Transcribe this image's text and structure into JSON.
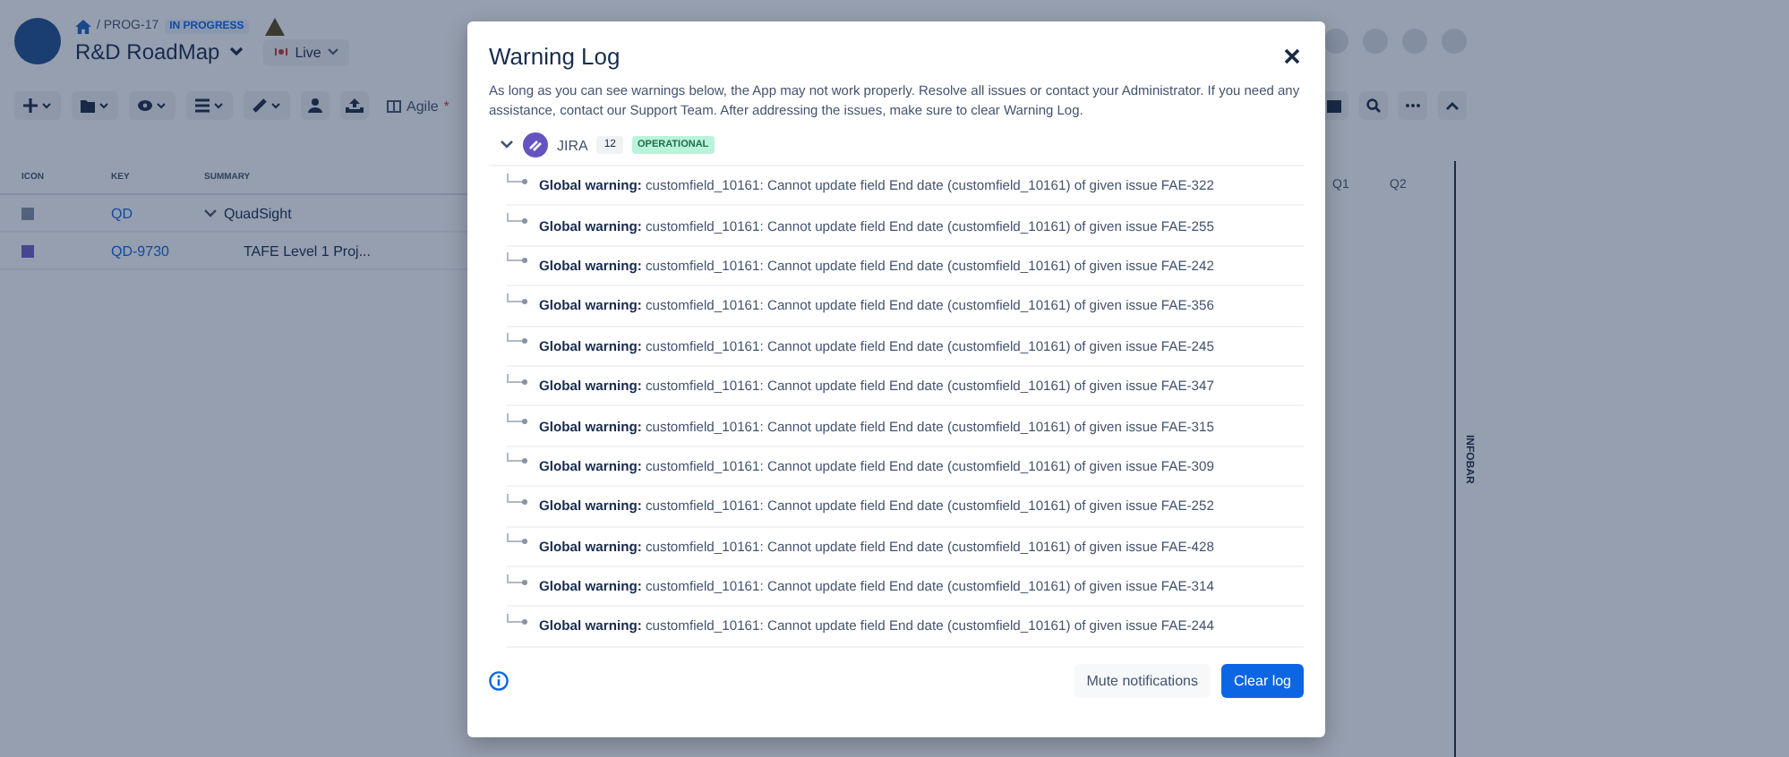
{
  "header": {
    "breadcrumb": "/ PROG-17",
    "status": "IN PROGRESS",
    "title": "R&D RoadMap",
    "mode": "Live"
  },
  "toolbar": {
    "view": "Agile",
    "view_modified": "*"
  },
  "table": {
    "columns": [
      "ICON",
      "KEY",
      "SUMMARY"
    ],
    "rows": [
      {
        "key": "QD",
        "summary": "QuadSight",
        "expanded": true,
        "children": [
          {
            "key": "QD-9730",
            "summary": "TAFE Level 1 Proj..."
          }
        ]
      }
    ]
  },
  "timeline": {
    "quarters": [
      "Q1",
      "Q2"
    ]
  },
  "infobar": {
    "label": "INFOBAR"
  },
  "dialog": {
    "title": "Warning Log",
    "description": "As long as you can see warnings below, the App may not work properly. Resolve all issues or contact your Administrator. If you need any assistance, contact our Support Team. After addressing the issues, make sure to clear Warning Log.",
    "source": {
      "name": "JIRA",
      "count": "12",
      "status": "OPERATIONAL",
      "expanded": true,
      "warnings": [
        "**Global warning:** customfield_10161: Cannot update field End date (customfield_10161) of given issue FAE-322",
        "**Global warning:** customfield_10161: Cannot update field End date (customfield_10161) of given issue FAE-255",
        "**Global warning:** customfield_10161: Cannot update field End date (customfield_10161) of given issue FAE-242",
        "**Global warning:** customfield_10161: Cannot update field End date (customfield_10161) of given issue FAE-356",
        "**Global warning:** customfield_10161: Cannot update field End date (customfield_10161) of given issue FAE-245",
        "**Global warning:** customfield_10161: Cannot update field End date (customfield_10161) of given issue FAE-347",
        "**Global warning:** customfield_10161: Cannot update field End date (customfield_10161) of given issue FAE-315",
        "**Global warning:** customfield_10161: Cannot update field End date (customfield_10161) of given issue FAE-309",
        "**Global warning:** customfield_10161: Cannot update field End date (customfield_10161) of given issue FAE-252",
        "**Global warning:** customfield_10161: Cannot update field End date (customfield_10161) of given issue FAE-428",
        "**Global warning:** customfield_10161: Cannot update field End date (customfield_10161) of given issue FAE-314",
        "**Global warning:** customfield_10161: Cannot update field End date (customfield_10161) of given issue FAE-244"
      ]
    },
    "buttons": [
      "Mute notifications",
      "Clear log"
    ]
  }
}
